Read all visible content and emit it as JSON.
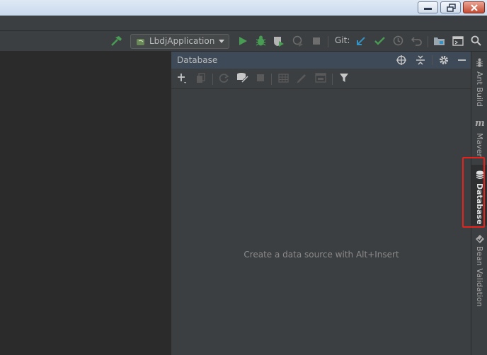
{
  "toolbar": {
    "run_configuration": "LbdjApplication",
    "git_label": "Git:"
  },
  "database_panel": {
    "title": "Database",
    "empty_hint": "Create a data source with Alt+Insert"
  },
  "right_sidebar": {
    "tabs": [
      {
        "label": "Ant Build"
      },
      {
        "label": "Maven"
      },
      {
        "label": "Database",
        "active": true
      },
      {
        "label": "Bean Validation"
      }
    ]
  },
  "colors": {
    "accent_green": "#499c54",
    "accent_blue": "#3592c4",
    "highlight_red": "#e8221a"
  }
}
